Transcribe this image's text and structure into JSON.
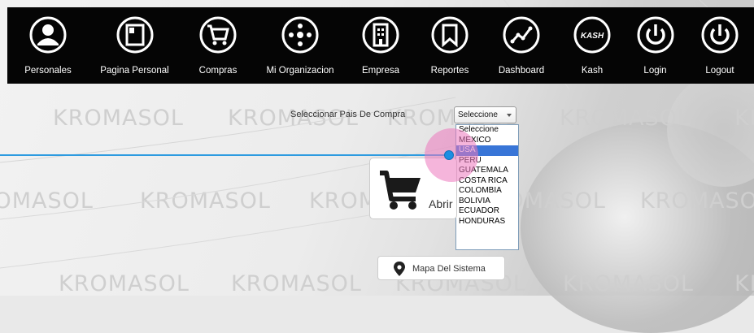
{
  "nav": {
    "items": [
      {
        "label": "Personales",
        "icon": "user-icon"
      },
      {
        "label": "Pagina Personal",
        "icon": "profile-page-icon"
      },
      {
        "label": "Compras",
        "icon": "shopping-cart-icon"
      },
      {
        "label": "Mi Organizacion",
        "icon": "organization-icon"
      },
      {
        "label": "Empresa",
        "icon": "building-icon"
      },
      {
        "label": "Reportes",
        "icon": "bookmark-icon"
      },
      {
        "label": "Dashboard",
        "icon": "line-chart-icon"
      },
      {
        "label": "Kash",
        "icon": "kash-icon",
        "icon_text": "KASH"
      },
      {
        "label": "Login",
        "icon": "power-icon"
      },
      {
        "label": "Logout",
        "icon": "power-icon"
      }
    ]
  },
  "watermark": {
    "text": "KROMASOL"
  },
  "country": {
    "label": "Seleccionar Pais De Compra",
    "selected": "Seleccione",
    "options": [
      "Seleccione",
      "MEXICO",
      "USA",
      "PERU",
      "GUATEMALA",
      "COSTA RICA",
      "COLOMBIA",
      "BOLIVIA",
      "ECUADOR",
      "HONDURAS"
    ],
    "highlighted": "USA"
  },
  "cart_button": {
    "label": "Abrir"
  },
  "map_button": {
    "label": "Mapa Del Sistema"
  },
  "colors": {
    "navbar": "#050505",
    "accent": "#3875d7",
    "line": "#2d9be0",
    "halo": "#ec78be"
  }
}
